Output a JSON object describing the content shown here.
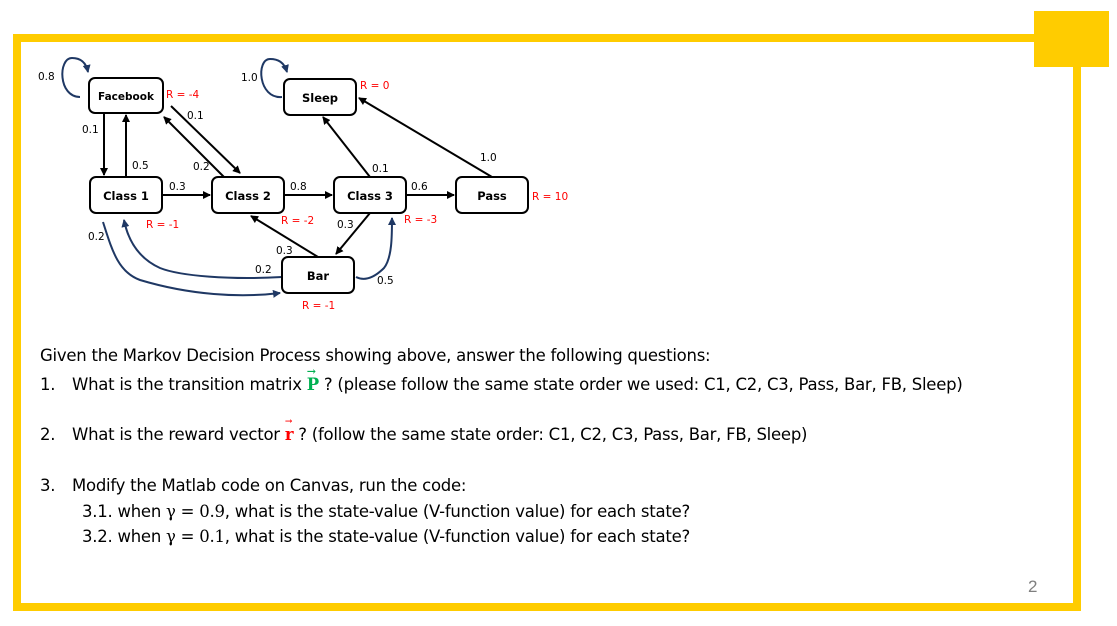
{
  "slide": {
    "page_number": "2",
    "accent_color": "#FFCC00"
  },
  "diagram": {
    "nodes": [
      {
        "id": "facebook",
        "label": "Facebook",
        "reward": "R = -4"
      },
      {
        "id": "sleep",
        "label": "Sleep",
        "reward": "R = 0"
      },
      {
        "id": "class1",
        "label": "Class 1",
        "reward": "R = -1"
      },
      {
        "id": "class2",
        "label": "Class 2",
        "reward": "R = -2"
      },
      {
        "id": "class3",
        "label": "Class 3",
        "reward": "R = -3"
      },
      {
        "id": "pass",
        "label": "Pass",
        "reward": "R = 10"
      },
      {
        "id": "bar",
        "label": "Bar",
        "reward": "R = -1"
      }
    ],
    "edges": [
      {
        "from": "facebook",
        "to": "facebook",
        "p": "0.8"
      },
      {
        "from": "facebook",
        "to": "class1",
        "p": "0.1"
      },
      {
        "from": "facebook",
        "to": "class2",
        "p": "0.1"
      },
      {
        "from": "sleep",
        "to": "sleep",
        "p": "1.0"
      },
      {
        "from": "class1",
        "to": "facebook",
        "p": "0.5"
      },
      {
        "from": "class1",
        "to": "class2",
        "p": "0.3"
      },
      {
        "from": "class1",
        "to": "bar",
        "p": "0.2"
      },
      {
        "from": "class2",
        "to": "facebook",
        "p": "0.2"
      },
      {
        "from": "class2",
        "to": "class3",
        "p": "0.8"
      },
      {
        "from": "class3",
        "to": "sleep",
        "p": "0.1"
      },
      {
        "from": "class3",
        "to": "pass",
        "p": "0.6"
      },
      {
        "from": "class3",
        "to": "bar",
        "p": "0.3"
      },
      {
        "from": "pass",
        "to": "sleep",
        "p": "1.0"
      },
      {
        "from": "bar",
        "to": "class1",
        "p": "0.2"
      },
      {
        "from": "bar",
        "to": "class2",
        "p": "0.3"
      },
      {
        "from": "bar",
        "to": "class3",
        "p": "0.5"
      }
    ]
  },
  "questions": {
    "intro": "Given the Markov Decision Process showing above, answer the following questions:",
    "q1": {
      "number": "1.",
      "before": "What is the transition matrix ",
      "symbol": "P",
      "after": " ? (please follow the same state order we used: C1, C2, C3, Pass, Bar, FB, Sleep)"
    },
    "q2": {
      "number": "2.",
      "before": "What is the reward vector ",
      "symbol": "r",
      "after": " ? (follow the same state order: C1, C2, C3, Pass, Bar, FB, Sleep)"
    },
    "q3": {
      "number": "3.",
      "text": "Modify the Matlab code on Canvas, run the code:",
      "sub1": {
        "prefix": "3.1. when ",
        "math": "γ = 0.9",
        "suffix": ", what is the state-value (V-function value) for each state?"
      },
      "sub2": {
        "prefix": "3.2. when ",
        "math": "γ = 0.1",
        "suffix": ", what is the state-value (V-function value) for each state?"
      }
    }
  }
}
